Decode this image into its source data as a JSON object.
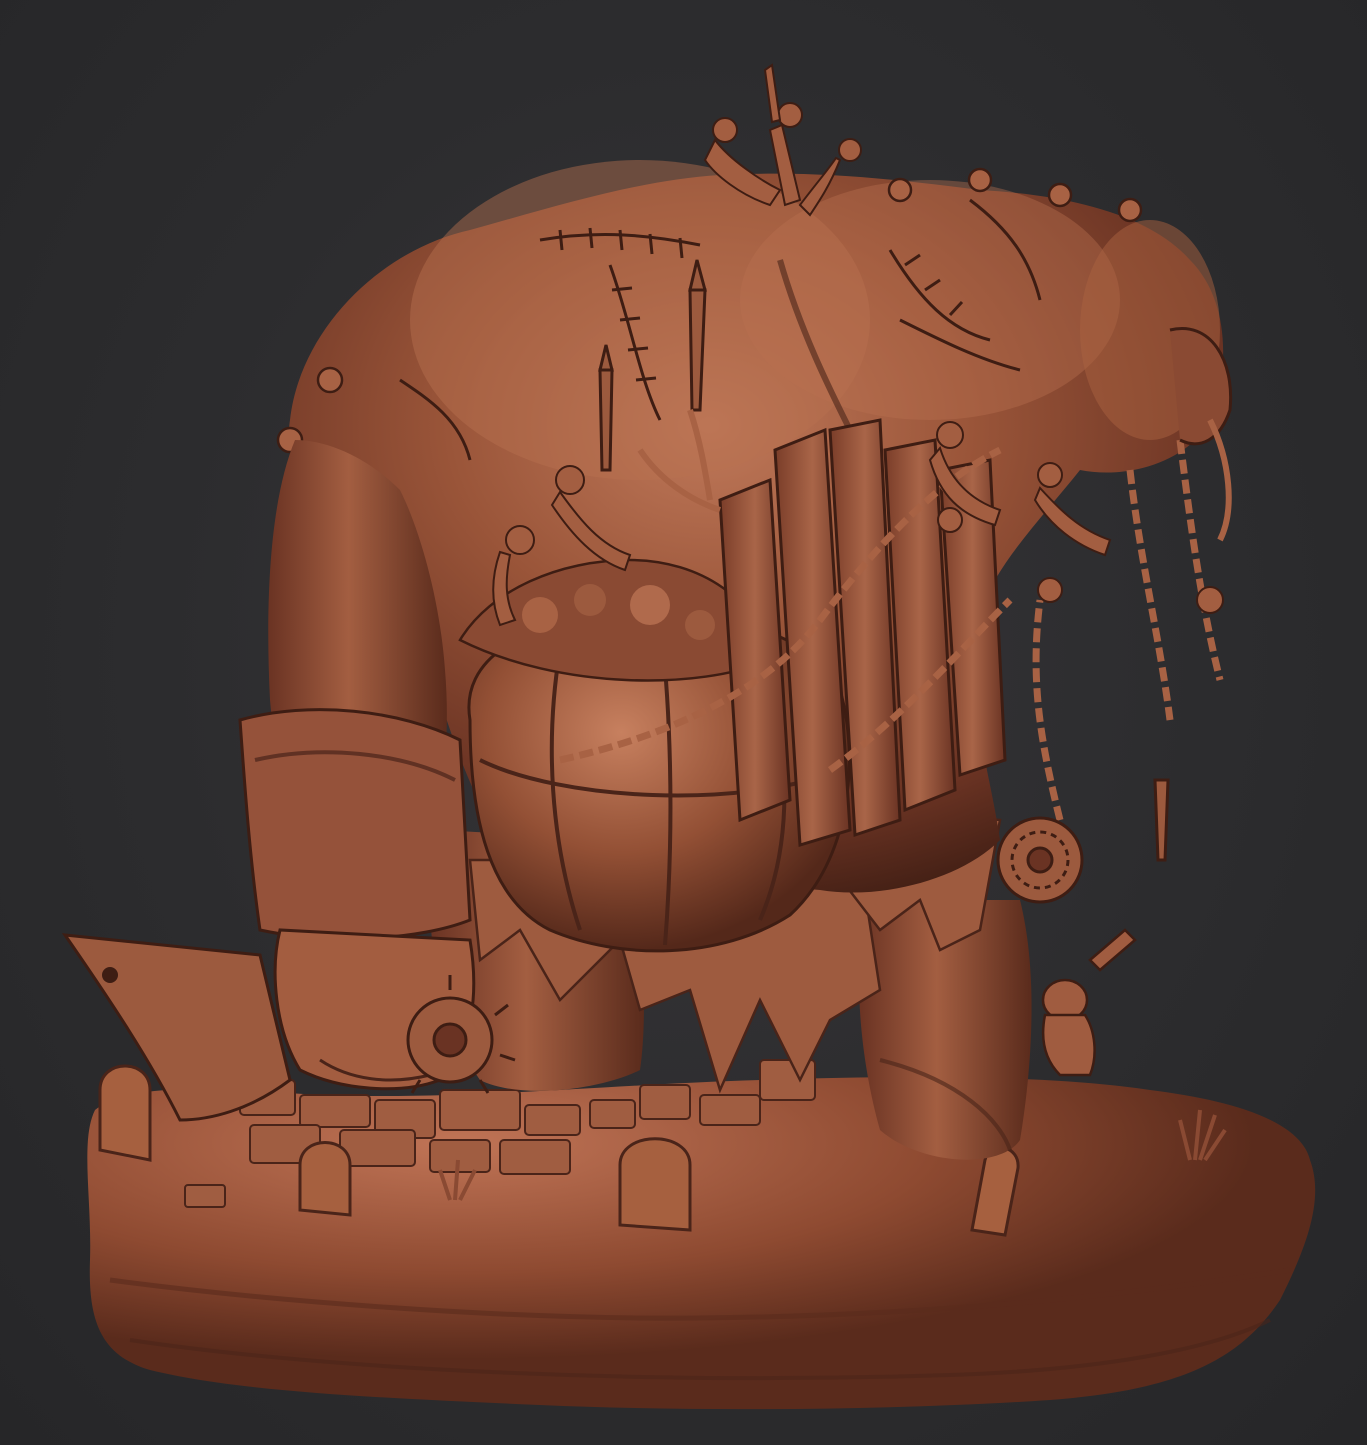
{
  "scene": {
    "subject": "sculpt-render",
    "colors": {
      "background": "#2b2b2d",
      "clay_base": "#8a4a33",
      "clay_light": "#b06a4c",
      "clay_highlight": "#c98463",
      "clay_shadow": "#4a2419",
      "clay_deep": "#2e150e"
    }
  }
}
